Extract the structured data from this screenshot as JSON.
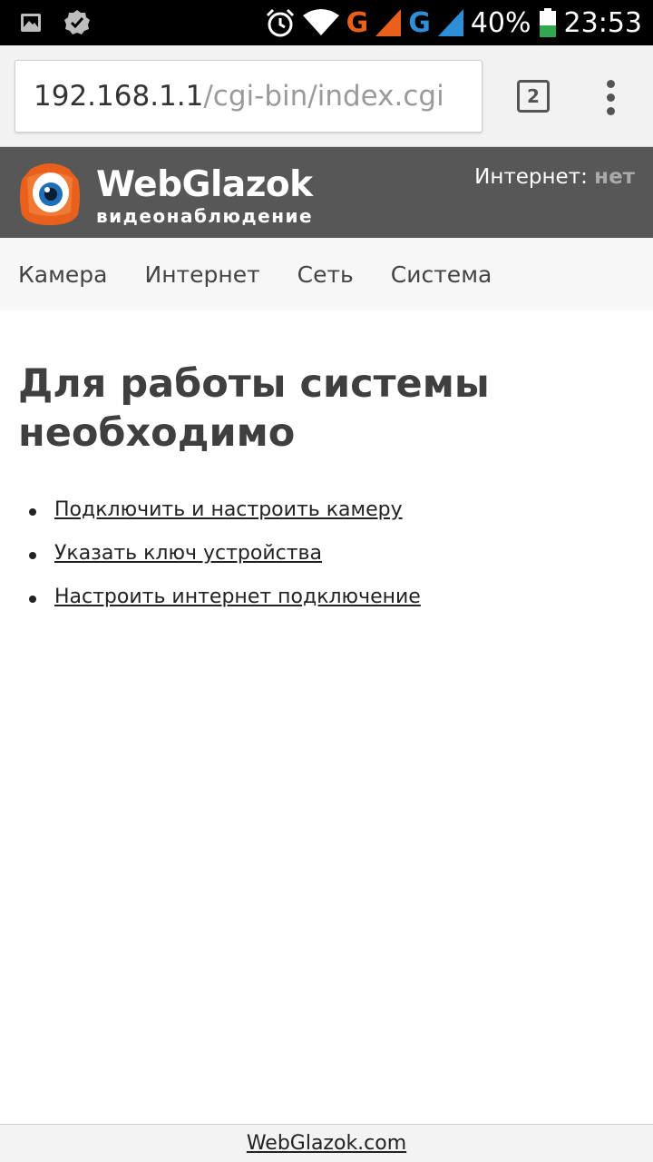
{
  "status_bar": {
    "battery_percent": "40%",
    "time": "23:53",
    "network_type_1": "G",
    "network_type_2": "G",
    "icons": [
      "gallery-icon",
      "check-badge-icon",
      "alarm-icon",
      "wifi-icon",
      "signal-icon",
      "battery-icon"
    ],
    "colors": {
      "network_1": "#e8601c",
      "network_2": "#2f8fd6",
      "battery": "#2fa84f"
    }
  },
  "browser": {
    "url_host": "192.168.1.1",
    "url_path": "/cgi-bin/index.cgi",
    "tab_count": "2"
  },
  "header": {
    "brand_name": "WebGlazok",
    "brand_tagline": "видеонаблюдение",
    "internet_label": "Интернет:",
    "internet_value": "нет",
    "colors": {
      "background": "#575757",
      "logo_orange": "#e8601c"
    }
  },
  "nav": {
    "items": [
      {
        "label": "Камера"
      },
      {
        "label": "Интернет"
      },
      {
        "label": "Сеть"
      },
      {
        "label": "Система"
      }
    ]
  },
  "main": {
    "title": "Для работы системы необходимо",
    "tasks": [
      {
        "label": "Подключить и настроить камеру"
      },
      {
        "label": "Указать ключ устройства"
      },
      {
        "label": "Настроить интернет подключение"
      }
    ]
  },
  "footer": {
    "link": "WebGlazok.com"
  }
}
